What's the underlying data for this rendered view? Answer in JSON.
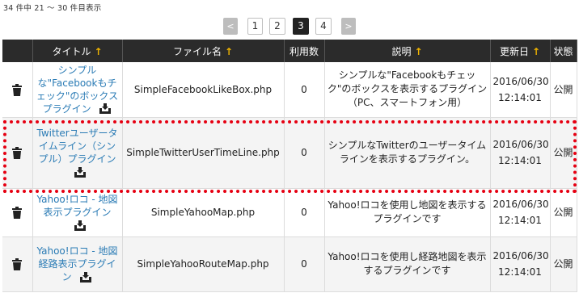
{
  "result_count": "34 件中 21 ～ 30 件目表示",
  "pagination": {
    "prev": "<",
    "pages": [
      "1",
      "2",
      "3",
      "4"
    ],
    "current": "3",
    "next": ">"
  },
  "table": {
    "headers": {
      "action": "",
      "title": "タイトル",
      "file": "ファイル名",
      "usage": "利用数",
      "description": "説明",
      "updated": "更新日",
      "status": "状態"
    },
    "sort_arrow": "↑",
    "rows": [
      {
        "title": "シンプルな\"Facebookもチェック\"のボックスプラグイン",
        "file": "SimpleFacebookLikeBox.php",
        "usage": "0",
        "description": "シンプルな\"Facebookもチェック\"のボックスを表示するプラグイン（PC、スマートフォン用）",
        "date": "2016/06/30",
        "time": "12:14:01",
        "status": "公開"
      },
      {
        "title": "Twitterユーザータイムライン（シンプル）プラグイン",
        "file": "SimpleTwitterUserTimeLine.php",
        "usage": "0",
        "description": "シンプルなTwitterのユーザータイムラインを表示するプラグイン。",
        "date": "2016/06/30",
        "time": "12:14:01",
        "status": "公開"
      },
      {
        "title": "Yahoo!ロコ - 地図表示プラグイン",
        "file": "SimpleYahooMap.php",
        "usage": "0",
        "description": "Yahoo!ロコを使用し地図を表示するプラグインです",
        "date": "2016/06/30",
        "time": "12:14:01",
        "status": "公開"
      },
      {
        "title": "Yahoo!ロコ - 地図経路表示プラグイン",
        "file": "SimpleYahooRouteMap.php",
        "usage": "0",
        "description": "Yahoo!ロコを使用し経路地図を表示するプラグインです",
        "date": "2016/06/30",
        "time": "12:14:01",
        "status": "公開"
      }
    ]
  },
  "colors": {
    "header_bg": "#2b2b2b",
    "sort_arrow": "#f0b400",
    "link": "#2a7bb5",
    "highlight": "#e60012"
  },
  "icons": {
    "delete": "trash-icon",
    "download": "download-icon"
  }
}
